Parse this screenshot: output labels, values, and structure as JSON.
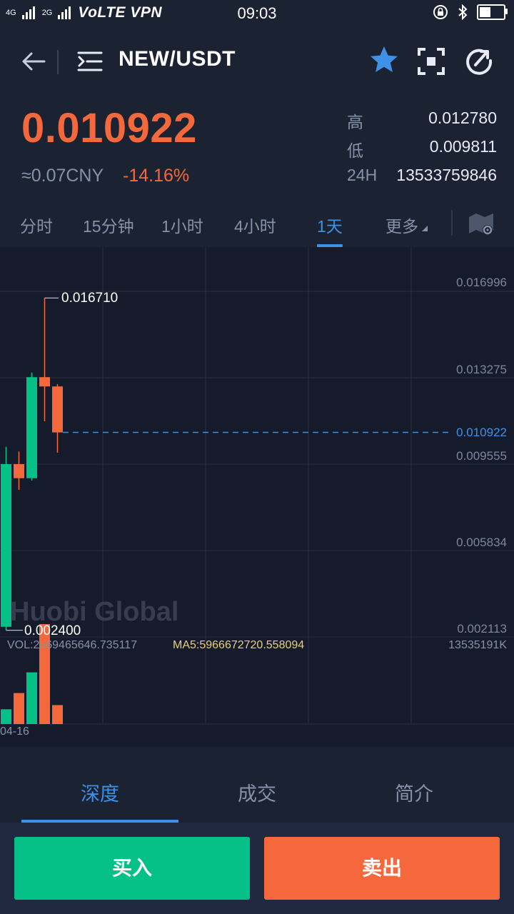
{
  "status_bar": {
    "network_left": "4G",
    "network_right": "2G",
    "carrier_text": "VoLTE VPN",
    "time": "09:03"
  },
  "header": {
    "pair": "NEW/USDT"
  },
  "ticker": {
    "last_price": "0.010922",
    "cny_value": "≈0.07CNY",
    "change_pct": "-14.16%",
    "high_label": "高",
    "high_value": "0.012780",
    "low_label": "低",
    "low_value": "0.009811",
    "vol24h_label": "24H",
    "vol24h_value": "13533759846"
  },
  "interval_tabs": [
    {
      "label": "分时",
      "active": false
    },
    {
      "label": "15分钟",
      "active": false
    },
    {
      "label": "1小时",
      "active": false
    },
    {
      "label": "4小时",
      "active": false
    },
    {
      "label": "1天",
      "active": true
    },
    {
      "label": "更多",
      "active": false
    }
  ],
  "chart_data": {
    "type": "candlestick",
    "y_ticks": [
      "0.016996",
      "0.013275",
      "0.009555",
      "0.005834",
      "0.002113"
    ],
    "current_price_label": "0.010922",
    "current_price": 0.010922,
    "ylim": [
      0.002113,
      0.016996
    ],
    "high_marker": "0.016710",
    "low_marker": "0.002400",
    "candles": [
      {
        "open": 0.009555,
        "high": 0.0103,
        "low": 0.0024,
        "close": 0.00255,
        "direction": "up"
      },
      {
        "open": 0.009555,
        "high": 0.0101,
        "low": 0.00845,
        "close": 0.00895,
        "direction": "down"
      },
      {
        "open": 0.00895,
        "high": 0.0135,
        "low": 0.00885,
        "close": 0.0133,
        "direction": "up"
      },
      {
        "open": 0.0133,
        "high": 0.01671,
        "low": 0.0114,
        "close": 0.0129,
        "direction": "down"
      },
      {
        "open": 0.0129,
        "high": 0.013,
        "low": 0.01005,
        "close": 0.010922,
        "direction": "down"
      }
    ],
    "volume": {
      "label": "VOL:2569465646.735117",
      "ma5_label": "MA5:5966672720.558094",
      "max_label": "13535191K",
      "max_value": 13535191000,
      "values": [
        2000000000,
        4200000000,
        7000000000,
        13535191000,
        2569465646
      ]
    },
    "x_labels": [
      "04-16"
    ],
    "watermark": "Huobi Global",
    "colors": {
      "up": "#06c187",
      "down": "#f5683c",
      "current_line": "#3d91e6"
    }
  },
  "bottom_tabs": [
    {
      "label": "深度",
      "active": true
    },
    {
      "label": "成交",
      "active": false
    },
    {
      "label": "简介",
      "active": false
    }
  ],
  "actions": {
    "buy_label": "买入",
    "sell_label": "卖出"
  },
  "colors": {
    "background": "#1b2232",
    "chart_bg": "#151b2a",
    "accent": "#3d91e6",
    "up": "#06c187",
    "down": "#f5683c"
  },
  "icons": [
    "back-arrow-icon",
    "menu-list-icon",
    "star-icon",
    "scan-icon",
    "share-icon",
    "chart-settings-icon",
    "bluetooth-icon",
    "lock-rotation-icon",
    "battery-icon"
  ]
}
